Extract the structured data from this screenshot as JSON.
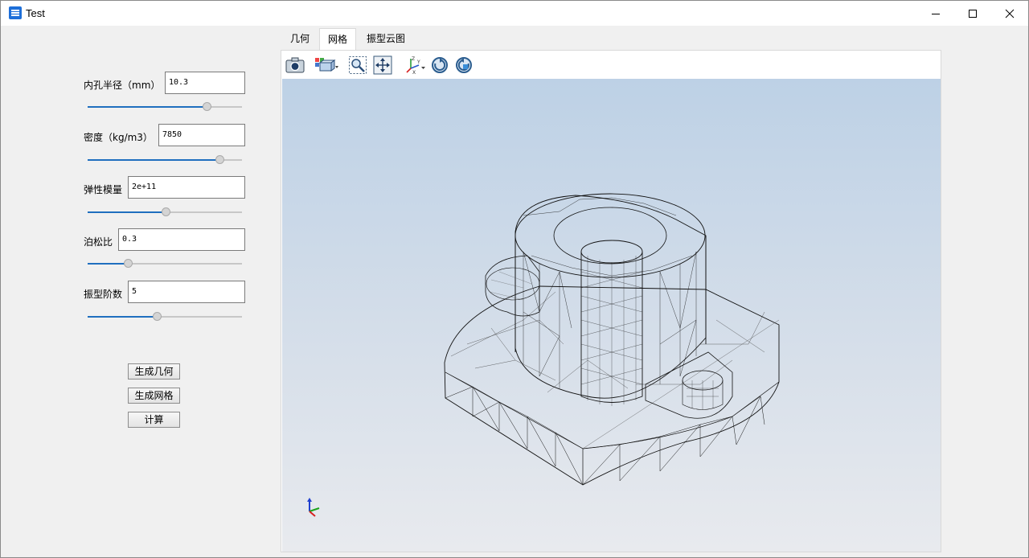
{
  "window": {
    "title": "Test",
    "controls": [
      "minimize",
      "maximize",
      "close"
    ]
  },
  "params": [
    {
      "label": "内孔半径（mm）",
      "value": "10.3",
      "slider": 0.79
    },
    {
      "label": "密度（kg/m3）",
      "value": "7850",
      "slider": 0.88
    },
    {
      "label": "弹性模量",
      "value": "2e+11",
      "slider": 0.51
    },
    {
      "label": "泊松比",
      "value": "0.3",
      "slider": 0.25
    },
    {
      "label": "振型阶数",
      "value": "5",
      "slider": 0.45
    }
  ],
  "buttons": {
    "generate_geometry": "生成几何",
    "generate_mesh": "生成网格",
    "compute": "计算"
  },
  "tabs": [
    {
      "label": "几何",
      "active": false
    },
    {
      "label": "网格",
      "active": true
    },
    {
      "label": "振型云图",
      "active": false
    }
  ],
  "toolbar": {
    "icons": [
      "camera-icon",
      "view-cube-icon",
      "zoom-box-icon",
      "fit-all-icon",
      "axes-icon",
      "rotate-cw-icon",
      "rotate-ccw-icon"
    ]
  },
  "viewport": {
    "background_top": "#bdd1e6",
    "background_bottom": "#e8eaee",
    "triad_colors": {
      "x": "#d62020",
      "y": "#1aa31a",
      "z": "#1f3fcf"
    }
  }
}
